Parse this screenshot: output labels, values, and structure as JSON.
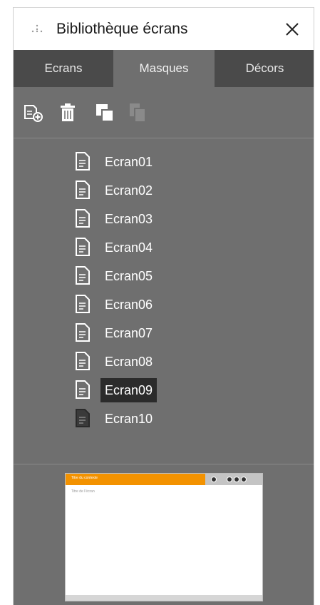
{
  "window": {
    "title": "Bibliothèque écrans"
  },
  "tabs": [
    {
      "label": "Ecrans",
      "active": false
    },
    {
      "label": "Masques",
      "active": true
    },
    {
      "label": "Décors",
      "active": false
    }
  ],
  "toolbar": [
    {
      "icon": "add-screen-icon",
      "enabled": true
    },
    {
      "icon": "trash-icon",
      "enabled": true
    },
    {
      "icon": "duplicate-icon",
      "enabled": true
    },
    {
      "icon": "paste-icon",
      "enabled": false
    }
  ],
  "screens": [
    {
      "label": "Ecran01"
    },
    {
      "label": "Ecran02"
    },
    {
      "label": "Ecran03"
    },
    {
      "label": "Ecran04"
    },
    {
      "label": "Ecran05"
    },
    {
      "label": "Ecran06"
    },
    {
      "label": "Ecran07"
    },
    {
      "label": "Ecran08"
    },
    {
      "label": "Ecran09",
      "selected": true
    },
    {
      "label": "Ecran10",
      "dark_icon": true
    }
  ],
  "preview": {
    "header_text": "Titre du contexte",
    "subtitle": "Titre de l'écran",
    "accent_color": "#f39200"
  }
}
